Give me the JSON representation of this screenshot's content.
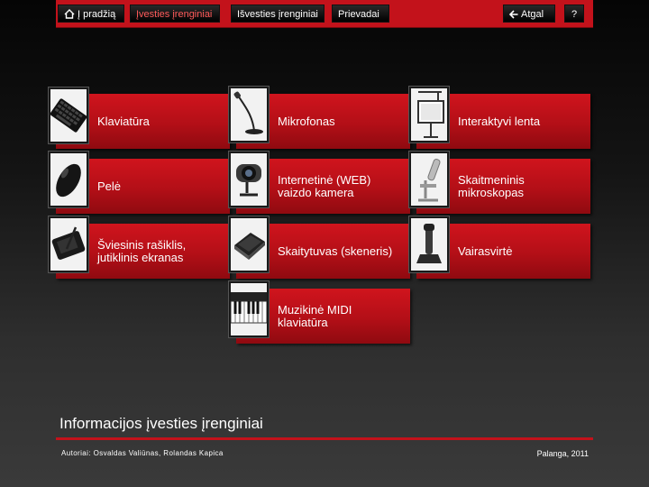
{
  "nav": {
    "home": "Į pradžią",
    "input_devices": "Įvesties įrenginiai",
    "output_devices": "Išvesties įrenginiai",
    "ports": "Prievadai",
    "back": "Atgal",
    "help": "?",
    "active_color": "#ff5a5a",
    "accent_color": "#c3121b"
  },
  "tiles": [
    {
      "label": "Klaviatūra",
      "icon": "keyboard-icon"
    },
    {
      "label": "Mikrofonas",
      "icon": "microphone-icon"
    },
    {
      "label": "Interaktyvi lenta",
      "icon": "whiteboard-icon"
    },
    {
      "label": "Pelė",
      "icon": "mouse-icon"
    },
    {
      "label": "Internetinė (WEB) vaizdo kamera",
      "icon": "webcam-icon"
    },
    {
      "label": "Skaitmeninis mikroskopas",
      "icon": "microscope-icon"
    },
    {
      "label": "Šviesinis rašiklis, jutiklinis ekranas",
      "icon": "tablet-icon"
    },
    {
      "label": "Skaitytuvas (skeneris)",
      "icon": "scanner-icon"
    },
    {
      "label": "Vairasvirtė",
      "icon": "joystick-icon"
    },
    {
      "label": "Muzikinė MIDI klaviatūra",
      "icon": "midi-keyboard-icon"
    }
  ],
  "page_title": "Informacijos įvesties įrenginiai",
  "footer": {
    "authors": "Autoriai: Osvaldas Valiūnas, Rolandas Kapica",
    "place": "Palanga, 2011"
  }
}
